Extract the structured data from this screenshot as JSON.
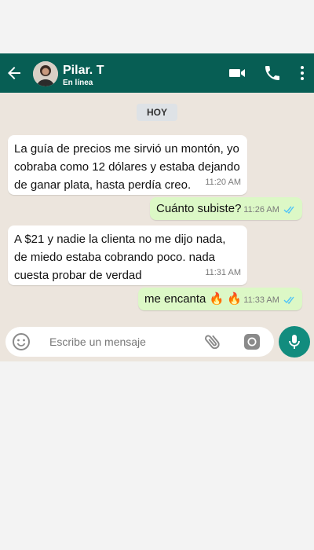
{
  "header": {
    "contact_name": "Pilar. T",
    "status": "En línea",
    "icons": [
      "back-arrow-icon",
      "video-call-icon",
      "phone-icon",
      "more-options-icon"
    ]
  },
  "chat": {
    "day_label": "HOY",
    "messages": [
      {
        "direction": "in",
        "text": "La guía de precios me sirvió un montón, yo cobraba como 12 dólares y estaba dejando de ganar plata, hasta perdía creo.",
        "time": "11:20 AM"
      },
      {
        "direction": "out",
        "text": "Cuánto subiste?",
        "time": "11:26 AM",
        "read": true
      },
      {
        "direction": "in",
        "text": "A $21 y nadie la clienta no me dijo nada, de miedo estaba cobrando poco. nada cuesta probar de verdad",
        "time": "11:31 AM"
      },
      {
        "direction": "out",
        "text": "me encanta 🔥 🔥",
        "time": "11:33 AM",
        "read": true
      }
    ]
  },
  "input": {
    "placeholder": "Escribe un mensaje",
    "icons": [
      "emoji-icon",
      "attach-icon",
      "camera-icon",
      "mic-icon"
    ]
  },
  "colors": {
    "header": "#075e54",
    "chat_background": "#ece5dd",
    "outgoing_bubble": "#dcf8c6",
    "incoming_bubble": "#ffffff",
    "mic_button": "#128c7e",
    "read_ticks": "#4fc3f7"
  }
}
